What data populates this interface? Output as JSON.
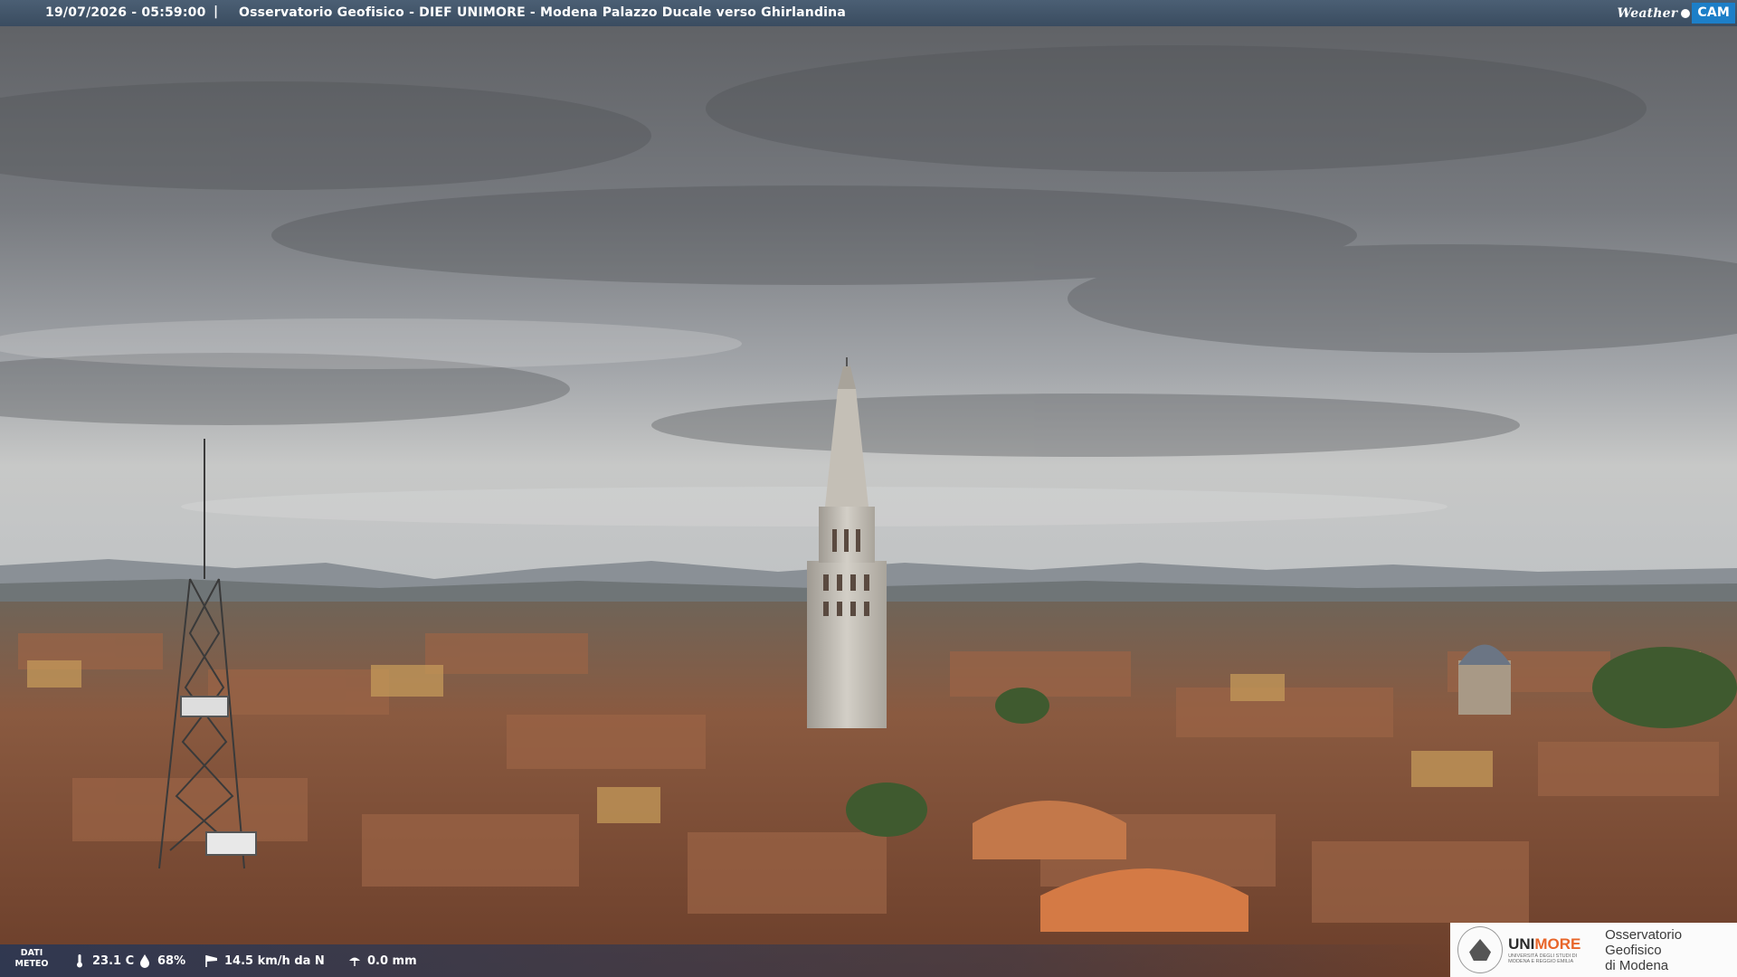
{
  "banner": {
    "timestamp": "19/07/2026 - 05:59:00",
    "separator": "|",
    "title": "Osservatorio Geofisico - DIEF UNIMORE - Modena Palazzo Ducale verso Ghirlandina"
  },
  "brand": {
    "weather": "Weather",
    "cam": "CAM"
  },
  "meteo": {
    "label_line1": "DATI",
    "label_line2": "METEO",
    "temperature": "23.1 C",
    "humidity": "68%",
    "wind": "14.5 km/h da N",
    "rain": "0.0 mm"
  },
  "institution": {
    "uni_prefix": "UNI",
    "uni_suffix": "MORE",
    "uni_small": "UNIVERSITÀ DEGLI STUDI DI MODENA E REGGIO EMILIA",
    "observatory_line1": "Osservatorio Geofisico",
    "observatory_line2": "di Modena"
  },
  "icons": [
    "thermometer-icon",
    "humidity-drop-icon",
    "wind-sock-icon",
    "rain-gauge-icon"
  ],
  "colors": {
    "banner": "#3f5166",
    "cam_accent": "#1d7fc8",
    "unimore_orange": "#e8662a"
  }
}
